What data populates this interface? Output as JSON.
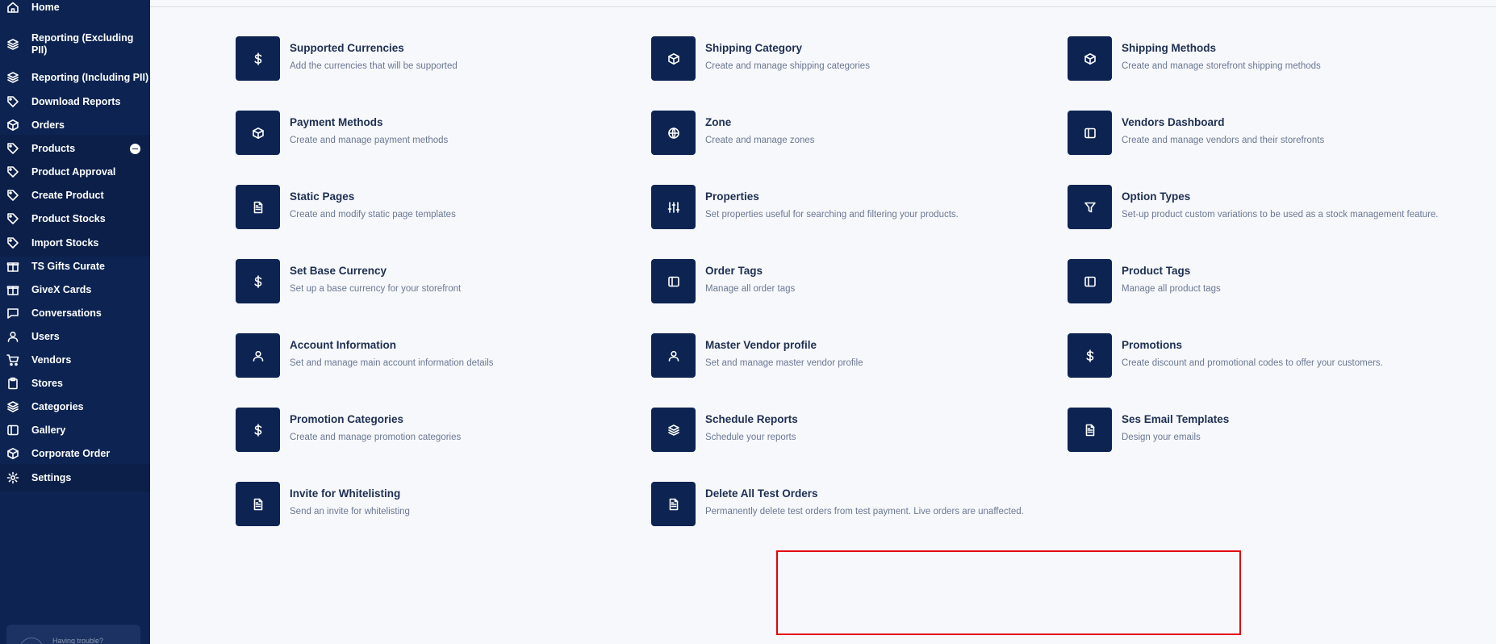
{
  "sidebar": {
    "items": [
      {
        "label": "Home",
        "icon": "home-icon"
      },
      {
        "label": "Reporting (Excluding PII)",
        "icon": "layers-icon"
      },
      {
        "label": "Reporting (Including PII)",
        "icon": "layers-icon"
      },
      {
        "label": "Download Reports",
        "icon": "tag-icon"
      },
      {
        "label": "Orders",
        "icon": "box-icon"
      },
      {
        "label": "Products",
        "icon": "tag-icon"
      },
      {
        "label": "Product Approval",
        "icon": "tag-icon"
      },
      {
        "label": "Create Product",
        "icon": "tag-icon"
      },
      {
        "label": "Product Stocks",
        "icon": "tag-icon"
      },
      {
        "label": "Import Stocks",
        "icon": "tag-icon"
      },
      {
        "label": "TS Gifts Curate",
        "icon": "gift-icon"
      },
      {
        "label": "GiveX Cards",
        "icon": "gift-icon"
      },
      {
        "label": "Conversations",
        "icon": "chat-icon"
      },
      {
        "label": "Users",
        "icon": "user-icon"
      },
      {
        "label": "Vendors",
        "icon": "cart-icon"
      },
      {
        "label": "Stores",
        "icon": "clipboard-icon"
      },
      {
        "label": "Categories",
        "icon": "layers-icon"
      },
      {
        "label": "Gallery",
        "icon": "sidebar-panel-icon"
      },
      {
        "label": "Corporate Order",
        "icon": "box-icon"
      },
      {
        "label": "Settings",
        "icon": "gear-icon"
      }
    ],
    "help_text": "Having trouble?"
  },
  "settings": {
    "cards": [
      {
        "title": "Supported Currencies",
        "desc": "Add the currencies that will be supported",
        "icon": "dollar-icon"
      },
      {
        "title": "Shipping Category",
        "desc": "Create and manage shipping categories",
        "icon": "box-icon"
      },
      {
        "title": "Shipping Methods",
        "desc": "Create and manage storefront shipping methods",
        "icon": "box-icon"
      },
      {
        "title": "Payment Methods",
        "desc": "Create and manage payment methods",
        "icon": "box-icon"
      },
      {
        "title": "Zone",
        "desc": "Create and manage zones",
        "icon": "globe-icon"
      },
      {
        "title": "Vendors Dashboard",
        "desc": "Create and manage vendors and their storefronts",
        "icon": "sidebar-panel-icon"
      },
      {
        "title": "Static Pages",
        "desc": "Create and modify static page templates",
        "icon": "document-icon"
      },
      {
        "title": "Properties",
        "desc": "Set properties useful for searching and filtering your products.",
        "icon": "sliders-icon"
      },
      {
        "title": "Option Types",
        "desc": "Set-up product custom variations to be used as a stock management feature.",
        "icon": "filter-icon"
      },
      {
        "title": "Set Base Currency",
        "desc": "Set up a base currency for your storefront",
        "icon": "dollar-icon"
      },
      {
        "title": "Order Tags",
        "desc": "Manage all order tags",
        "icon": "sidebar-panel-icon"
      },
      {
        "title": "Product Tags",
        "desc": "Manage all product tags",
        "icon": "sidebar-panel-icon"
      },
      {
        "title": "Account Information",
        "desc": "Set and manage main account information details",
        "icon": "user-icon"
      },
      {
        "title": "Master Vendor profile",
        "desc": "Set and manage master vendor profile",
        "icon": "user-icon"
      },
      {
        "title": "Promotions",
        "desc": "Create discount and promotional codes to offer your customers.",
        "icon": "dollar-icon"
      },
      {
        "title": "Promotion Categories",
        "desc": "Create and manage promotion categories",
        "icon": "dollar-icon"
      },
      {
        "title": "Schedule Reports",
        "desc": "Schedule your reports",
        "icon": "layers-icon"
      },
      {
        "title": "Ses Email Templates",
        "desc": "Design your emails",
        "icon": "document-icon"
      },
      {
        "title": "Invite for Whitelisting",
        "desc": "Send an invite for whitelisting",
        "icon": "document-icon"
      },
      {
        "title": "Delete All Test Orders",
        "desc": "Permanently delete test orders from test payment. Live orders are unaffected.",
        "icon": "document-icon"
      }
    ]
  },
  "colors": {
    "sidebar_bg": "#0d2452",
    "tile_bg": "#0d2452",
    "highlight": "#e3000f"
  }
}
